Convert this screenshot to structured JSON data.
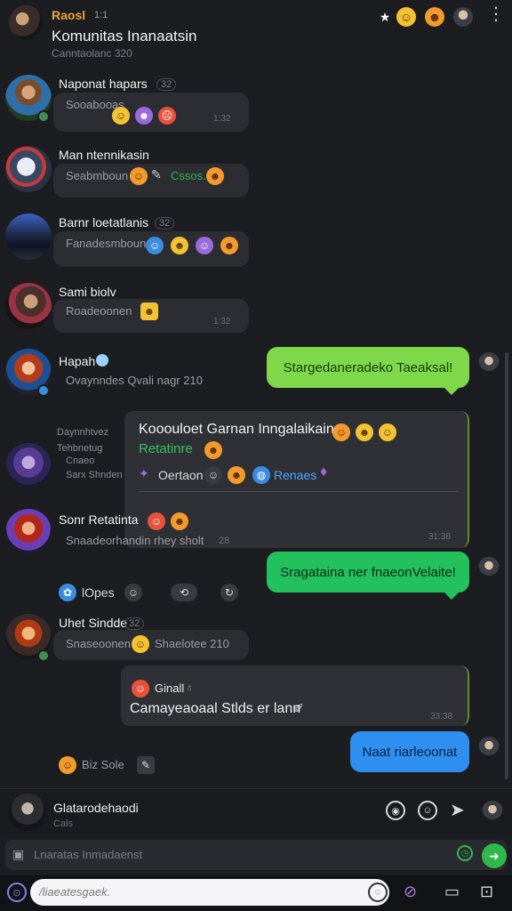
{
  "header": {
    "sender": "Raosl",
    "sender_time": "1:1",
    "title": "Komunitas Inanaatsin",
    "subtitle": "Canntaolanc 320",
    "icons": [
      "pin-icon",
      "emoji-face-icon",
      "emoji-pair-icon",
      "profile-icon",
      "more-menu-icon"
    ]
  },
  "messages": [
    {
      "name": "Naponat hapars",
      "count": "32",
      "preview": "Sooabooas",
      "time": "1:32"
    },
    {
      "name": "Man ntennikasin",
      "preview": "Seabmboun",
      "extra": "Cssos.",
      "time": ""
    },
    {
      "name": "Barnr loetatlanis",
      "count": "32",
      "preview": "Fanadesmboun",
      "time": ""
    },
    {
      "name": "Sami biolv",
      "preview": "Roadeoonen",
      "time": "1:32"
    },
    {
      "name": "Hapah",
      "preview": "Ovaynndes Qvali nagr 210",
      "time": ""
    },
    {
      "name": "Sonr Retatinta",
      "preview": "Snaadeorhandin rhey sholt",
      "time": "28"
    },
    {
      "name": "Uhet Sindde",
      "count": "32",
      "preview": "Snaseoonen",
      "extra": "Shaelotee 210",
      "time": ""
    }
  ],
  "side_labels": {
    "group_name": "Daynnhtvez",
    "group_line2": "Tehbnetug",
    "group_line3": "Cnaeo",
    "group_line4": "Sarx Shnden"
  },
  "outgoing": {
    "bubble1": "Stargedaneradeko Taeaksal!",
    "bubble2": "Sragataina ner fnaeonVelaite!",
    "bubble3": "Naat riarleoonat"
  },
  "quote": {
    "title": "Kooouloet Garnan Inngalaikain",
    "tag": "Retatinre",
    "line": "Oertaon",
    "link": "Renaes",
    "time": "31:38"
  },
  "reaction_row": {
    "label": "lOpes"
  },
  "reply_card": {
    "tag": "Ginall",
    "text": "Camayeaoaal Stlds er lann",
    "time": "33:38"
  },
  "small_row": {
    "label": "Biz Sole"
  },
  "footer": {
    "name": "Glatarodehaodi",
    "sub": "Cals",
    "compose_placeholder": "Lnaratas Inmadaenst",
    "search_placeholder": "/liaeatesgaek."
  },
  "colors": {
    "accent_orange": "#f2a33a",
    "bubble_lime": "#7fd84a",
    "bubble_green": "#22c15e",
    "bubble_blue": "#2f8ff0",
    "send_green": "#2fb84c"
  }
}
